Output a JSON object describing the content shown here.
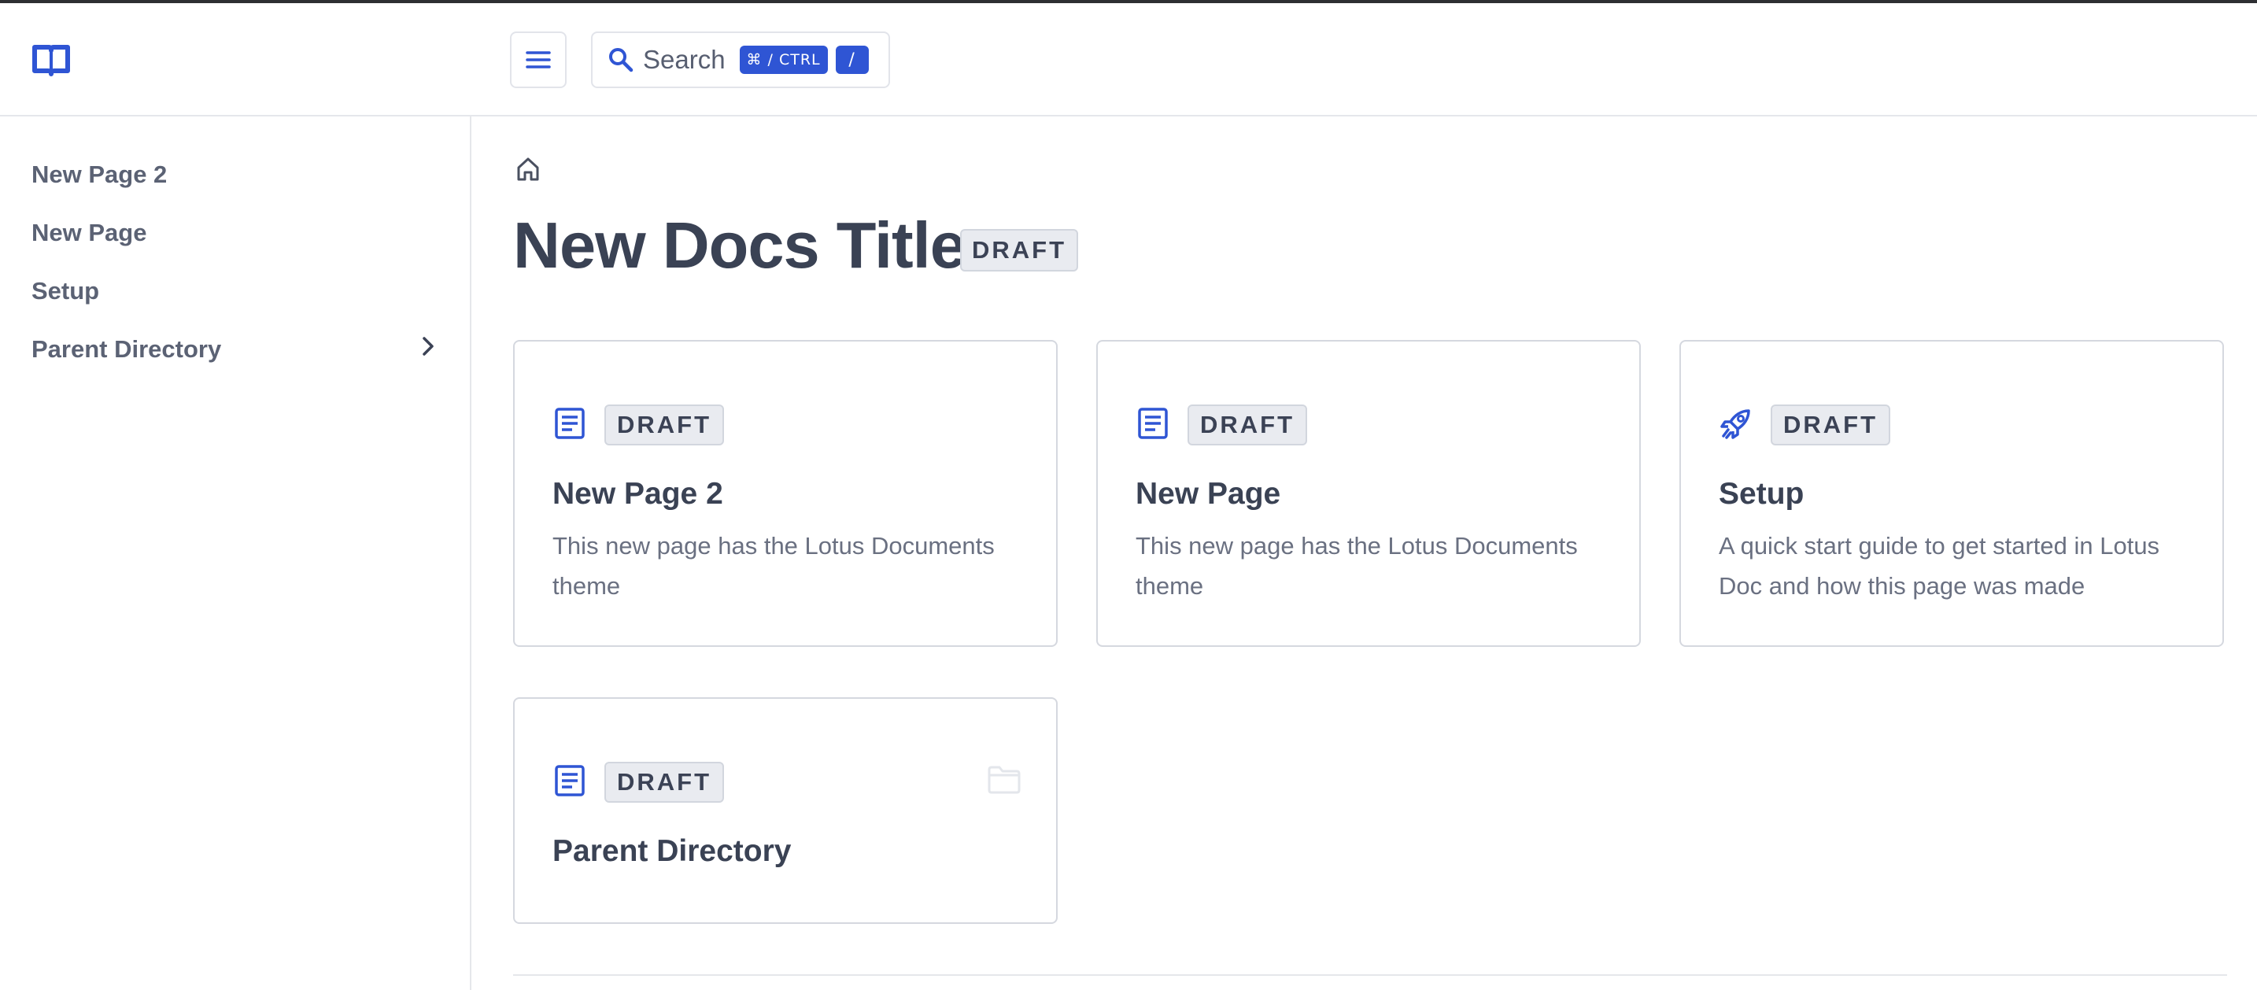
{
  "header": {
    "search_label": "Search",
    "search_shortcut_modifier": "⌘ / CTRL",
    "search_shortcut_key": "/"
  },
  "sidebar": {
    "items": [
      {
        "label": "New Page 2"
      },
      {
        "label": "New Page"
      },
      {
        "label": "Setup"
      },
      {
        "label": "Parent Directory",
        "has_children": true
      }
    ]
  },
  "main": {
    "title": "New Docs Title",
    "title_badge": "DRAFT",
    "cards": [
      {
        "icon": "document-icon",
        "badge": "DRAFT",
        "title": "New Page 2",
        "description": "This new page has the Lotus Documents theme"
      },
      {
        "icon": "document-icon",
        "badge": "DRAFT",
        "title": "New Page",
        "description": "This new page has the Lotus Documents theme"
      },
      {
        "icon": "rocket-icon",
        "badge": "DRAFT",
        "title": "Setup",
        "description": "A quick start guide to get started in Lotus Doc and how this page was made"
      },
      {
        "icon": "document-icon",
        "badge": "DRAFT",
        "title": "Parent Directory",
        "description": "",
        "secondary_icon": "folder-icon"
      }
    ]
  },
  "colors": {
    "accent": "#2f55d4",
    "text_primary": "#3a4254",
    "text_secondary": "#6a7081",
    "border": "#d5d8df",
    "badge_bg": "#e9ebf0"
  }
}
